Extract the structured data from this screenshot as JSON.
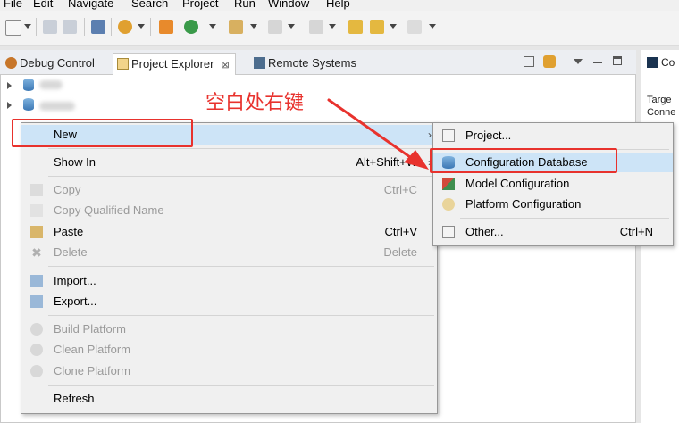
{
  "menubar": {
    "items": [
      "File",
      "Edit",
      "Navigate",
      "Search",
      "Project",
      "Run",
      "Window",
      "Help"
    ]
  },
  "tabs": [
    {
      "label": "Debug Control",
      "active": false
    },
    {
      "label": "Project Explorer",
      "active": true,
      "close": "⊠"
    },
    {
      "label": "Remote Systems",
      "active": false
    }
  ],
  "right_pane": {
    "tab": "Co",
    "lines": [
      "Targe",
      "Conne"
    ]
  },
  "annotation": {
    "text": "空白处右键",
    "color": "#e8322d"
  },
  "context_menu": {
    "items": [
      {
        "label": "New",
        "submenu": true
      },
      {
        "label": "Show In",
        "accel": "Alt+Shift+W",
        "submenu": true
      },
      {
        "label": "Copy",
        "accel": "Ctrl+C",
        "disabled": true
      },
      {
        "label": "Copy Qualified Name",
        "disabled": true
      },
      {
        "label": "Paste",
        "accel": "Ctrl+V"
      },
      {
        "label": "Delete",
        "accel": "Delete",
        "disabled": true
      },
      {
        "label": "Import..."
      },
      {
        "label": "Export..."
      },
      {
        "label": "Build Platform",
        "disabled": true
      },
      {
        "label": "Clean Platform",
        "disabled": true
      },
      {
        "label": "Clone Platform",
        "disabled": true
      },
      {
        "label": "Refresh"
      }
    ]
  },
  "submenu": {
    "items": [
      {
        "label": "Project..."
      },
      {
        "label": "Configuration Database"
      },
      {
        "label": "Model Configuration"
      },
      {
        "label": "Platform Configuration"
      },
      {
        "label": "Other...",
        "accel": "Ctrl+N"
      }
    ]
  }
}
